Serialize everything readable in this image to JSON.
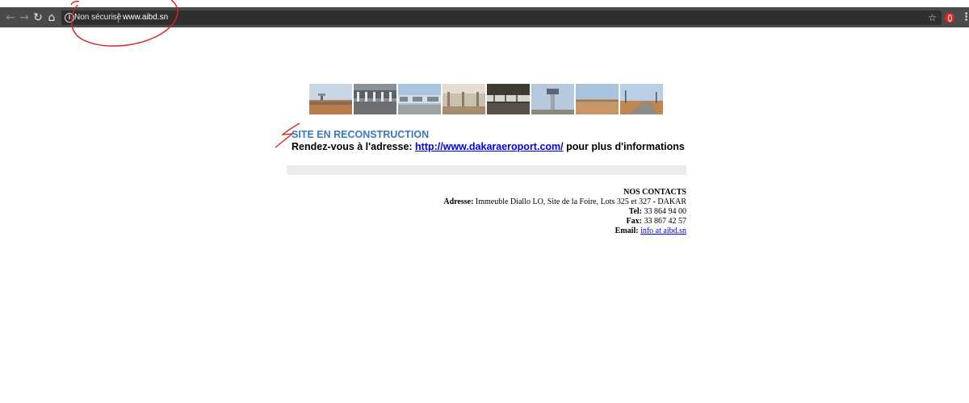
{
  "browser": {
    "security_label": "Non sécurisé",
    "url": "www.aibd.sn",
    "icons": {
      "back": "back-arrow-icon",
      "forward": "forward-arrow-icon",
      "reload": "reload-icon",
      "home": "home-icon",
      "info": "info-icon",
      "bookmark": "star-icon",
      "extension": "opera-extension-icon",
      "menu": "kebab-menu-icon"
    }
  },
  "page": {
    "photo_count": 8,
    "heading": "SITE EN RECONSTRUCTION",
    "redirect_prefix": "Rendez-vous à l'adresse: ",
    "redirect_link": "http://www.dakaraeroport.com/",
    "redirect_suffix": " pour plus d'informations",
    "heading_color": "#3a78c3",
    "contacts": {
      "title": "NOS CONTACTS",
      "address_label": "Adresse:",
      "address_value": "Immeuble Diallo LO, Site de la Foire, Lots 325 et 327 - DAKAR",
      "tel_label": "Tel:",
      "tel_value": "33 864 94 00",
      "fax_label": "Fax:",
      "fax_value": "33 867 42 57",
      "email_label": "Email:",
      "email_value": "info at aibd.sn"
    }
  },
  "colors": {
    "toolbar": "#4a4a4a",
    "omnibox": "#2f2f2f",
    "link": "#0000ee",
    "annotation": "#e02020"
  }
}
